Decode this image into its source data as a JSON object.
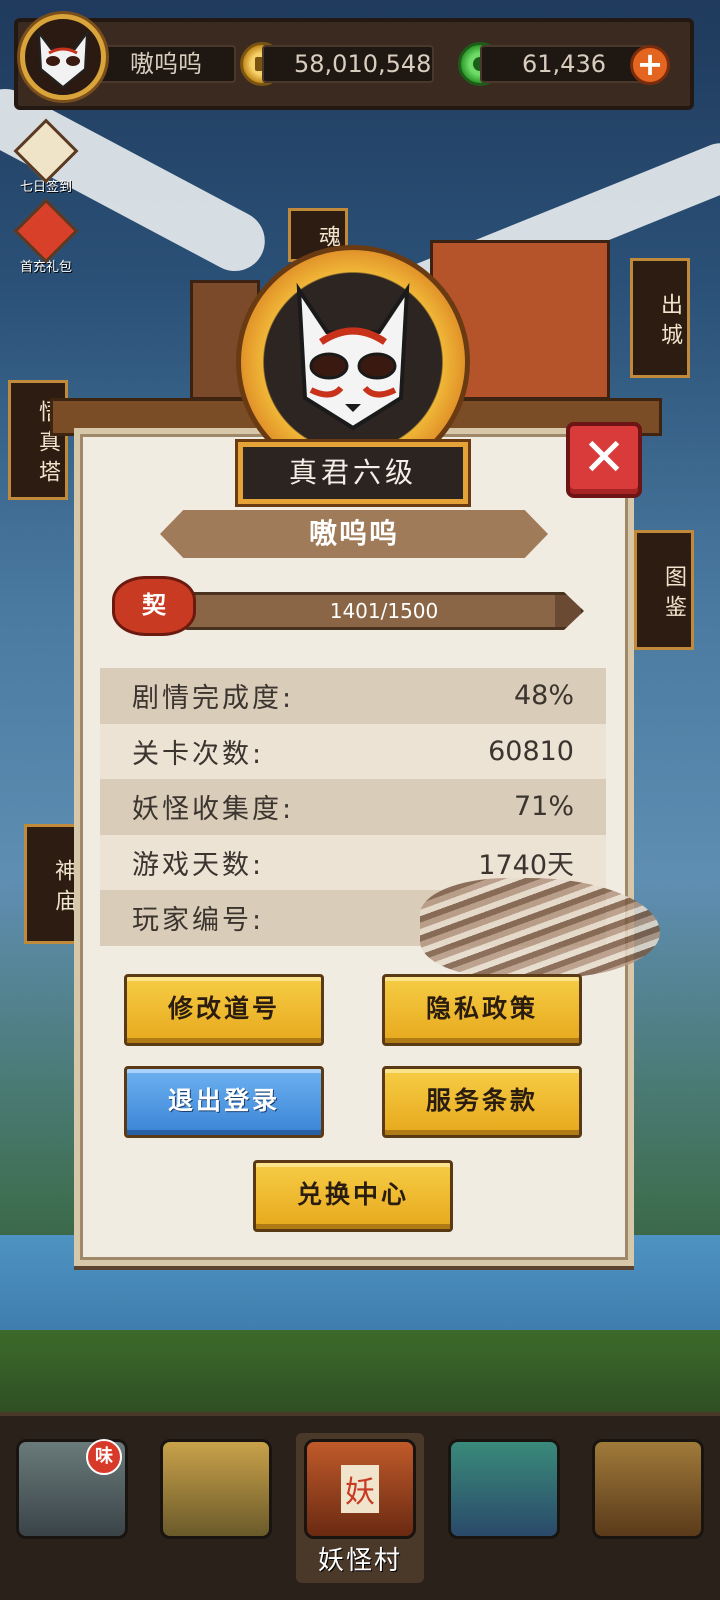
{
  "header": {
    "player_name": "嗷呜呜",
    "gold": "58,010,548",
    "jade": "61,436"
  },
  "side": {
    "checkin_label": "七日签到",
    "gift_label": "首充礼包",
    "signs": [
      "魂",
      "悟真塔",
      "出城",
      "图鉴",
      "神庙"
    ]
  },
  "profile": {
    "rank": "真君六级",
    "name": "嗷呜呜",
    "seal_char": "契",
    "xp_text": "1401/1500",
    "xp_progress": 0.934,
    "stats": [
      {
        "label": "剧情完成度:",
        "value": "48%"
      },
      {
        "label": "关卡次数:",
        "value": "60810"
      },
      {
        "label": "妖怪收集度:",
        "value": "71%"
      },
      {
        "label": "游戏天数:",
        "value": "1740天"
      },
      {
        "label": "玩家编号:",
        "value": ""
      }
    ],
    "buttons": {
      "edit_name": "修改道号",
      "privacy": "隐私政策",
      "logout": "退出登录",
      "terms": "服务条款",
      "redeem": "兑换中心"
    }
  },
  "nav": {
    "badge": "味",
    "village_label": "妖怪村",
    "village_sign": "妖"
  },
  "colors": {
    "gold_button": "#e7a81d",
    "blue_button": "#3a84d6",
    "close_red": "#d93a3a"
  }
}
